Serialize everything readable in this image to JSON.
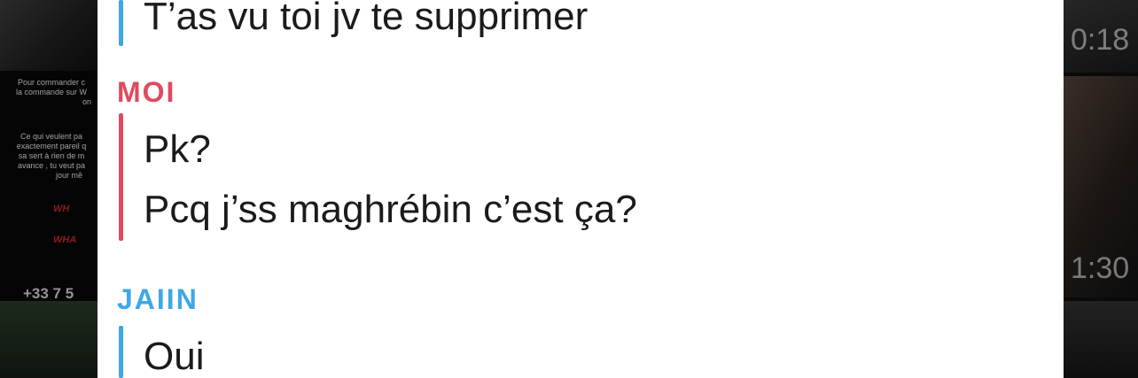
{
  "background": {
    "left_promo_lines_1": [
      "Pour commander c",
      "la commande sur W",
      "on"
    ],
    "left_promo_lines_2": [
      "Ce qui veulent pa",
      "exactement pareil q",
      "sa sert à rien de m",
      "avance , tu veut pa",
      "jour mê"
    ],
    "left_red_1": "WH",
    "left_red_2": "WHA",
    "left_phone": "+33 7 5",
    "right_time_1": "0:18",
    "right_time_2": "1:30"
  },
  "chat": {
    "messages": [
      {
        "sender": "",
        "text": "T’as vu toi jv te supprimer"
      },
      {
        "sender": "MOI",
        "text": "Pk?"
      },
      {
        "sender": "",
        "text": "Pcq j’ss maghrébin c’est ça?"
      },
      {
        "sender": "JAIIN",
        "text": "Oui"
      }
    ]
  },
  "colors": {
    "jaiin": "#3ea7e6",
    "moi": "#e04a5f",
    "panel": "#ffffff"
  }
}
